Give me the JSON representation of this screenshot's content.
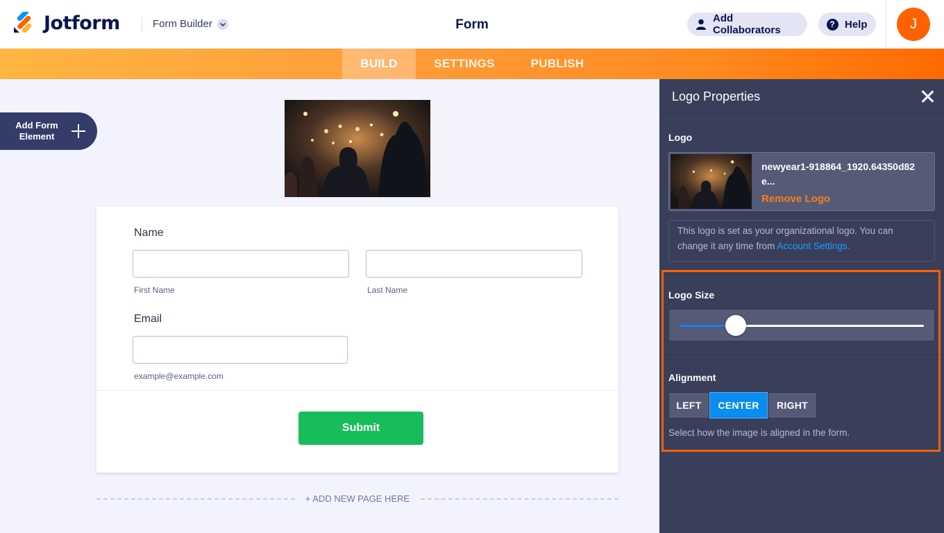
{
  "header": {
    "brand": "Jotform",
    "builder_label": "Form Builder",
    "page_title": "Form",
    "collab_label": "Add Collaborators",
    "help_label": "Help",
    "avatar_initial": "J"
  },
  "nav": {
    "tabs": [
      {
        "label": "BUILD",
        "active": true
      },
      {
        "label": "SETTINGS",
        "active": false
      },
      {
        "label": "PUBLISH",
        "active": false
      }
    ]
  },
  "sidebar": {
    "add_element_label": "Add Form Element"
  },
  "form": {
    "name_label": "Name",
    "first_name_sublabel": "First Name",
    "last_name_sublabel": "Last Name",
    "email_label": "Email",
    "email_sublabel": "example@example.com",
    "submit_label": "Submit",
    "add_page_label": "+ ADD NEW PAGE HERE"
  },
  "panel": {
    "title": "Logo Properties",
    "logo_section": "Logo",
    "file_name": "newyear1-918864_1920.64350d82e...",
    "remove_label": "Remove Logo",
    "info_text": "This logo is set as your organizational logo. You can change it any time from ",
    "info_link": "Account Settings.",
    "size_section": "Logo Size",
    "size_value": 0.23,
    "alignment_section": "Alignment",
    "alignment_options": [
      "LEFT",
      "CENTER",
      "RIGHT"
    ],
    "alignment_selected": "CENTER",
    "alignment_help": "Select how the image is aligned in the form."
  },
  "colors": {
    "brand_navy": "#0a1551",
    "accent_orange": "#ff6100",
    "submit_green": "#18bd5b",
    "selected_blue": "#0a8cf0",
    "highlight_orange": "#ff5f00"
  }
}
